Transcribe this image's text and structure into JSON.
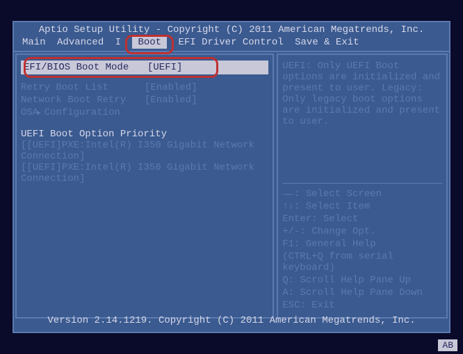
{
  "header": {
    "title": "Aptio Setup Utility - Copyright (C) 2011 American Megatrends, Inc."
  },
  "menu": {
    "items": [
      "Main",
      "Advanced",
      "I",
      "Boot",
      "EFI Driver Control",
      "Save & Exit"
    ],
    "active_index": 3
  },
  "boot": {
    "mode_label": "EFI/BIOS Boot Mode",
    "mode_value": "[UEFI]",
    "retry_list_label": "Retry Boot List",
    "retry_list_value": "[Enabled]",
    "network_retry_label": "Network Boot Retry",
    "network_retry_value": "[Enabled]",
    "osa_label": "OSA Configuration",
    "priority_header": "UEFI Boot Option Priority",
    "priority_items": [
      "[[UEFI]PXE:Intel(R) I350 Gigabit Network Connection]",
      "[[UEFI]PXE:Intel(R) I350 Gigabit Network Connection]"
    ]
  },
  "help": {
    "text": "UEFI: Only UEFI Boot options are initialized and present to user. Legacy: Only legacy boot options are initialized and present to user."
  },
  "keys": {
    "k1": "→←: Select Screen",
    "k2": "↑↓: Select Item",
    "k3": "Enter: Select",
    "k4": "+/-: Change Opt.",
    "k5": "F1: General Help",
    "k6": " (CTRL+Q from serial keyboard)",
    "k7": "Q: Scroll Help Pane Up",
    "k8": "A: Scroll Help Pane Down",
    "k9": "ESC: Exit"
  },
  "footer": {
    "version": "Version 2.14.1219. Copyright (C) 2011 American Megatrends, Inc.",
    "badge": "AB"
  }
}
